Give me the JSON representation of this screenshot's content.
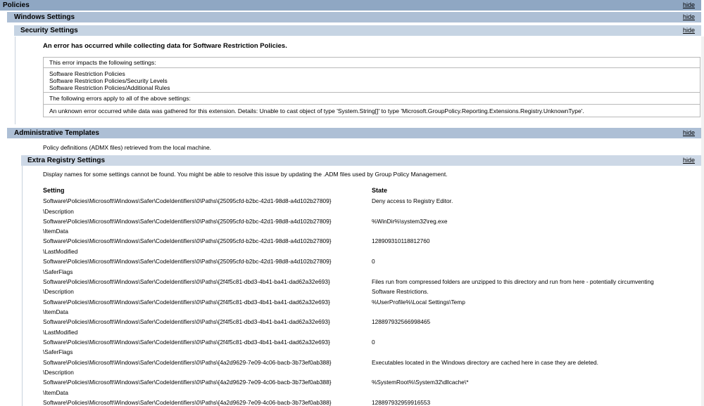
{
  "policies": {
    "title": "Policies",
    "hide": "hide"
  },
  "windows_settings": {
    "title": "Windows Settings",
    "hide": "hide"
  },
  "security_settings": {
    "title": "Security Settings",
    "hide": "hide"
  },
  "error": {
    "title": "An error has occurred while collecting data for Software Restriction Policies.",
    "impacts_label": "This error impacts the following settings:",
    "impacted": [
      "Software Restriction Policies",
      "Software Restriction Policies/Security Levels",
      "Software Restriction Policies/Additional Rules"
    ],
    "applies_label": "The following errors apply to all of the above settings:",
    "detail": "An unknown error occurred while data was gathered for this extension. Details: Unable to cast object of type 'System.String[]' to type 'Microsoft.GroupPolicy.Reporting.Extensions.Registry.UnknownType'."
  },
  "admin_templates": {
    "title": "Administrative Templates",
    "hide": "hide",
    "desc": "Policy definitions (ADMX files) retrieved from the local machine."
  },
  "extra_registry": {
    "title": "Extra Registry Settings",
    "hide": "hide",
    "desc": "Display names for some settings cannot be found. You might be able to resolve this issue by updating the .ADM files used by Group Policy Management.",
    "col_setting": "Setting",
    "col_state": "State",
    "rows": [
      {
        "setting": "Software\\Policies\\Microsoft\\Windows\\Safer\\CodeIdentifiers\\0\\Paths\\{25095cfd-b2bc-42d1-98d8-a4d102b27809}",
        "setting2": "\\Description",
        "state": "Deny access to Registry Editor.",
        "state2": ""
      },
      {
        "setting": "Software\\Policies\\Microsoft\\Windows\\Safer\\CodeIdentifiers\\0\\Paths\\{25095cfd-b2bc-42d1-98d8-a4d102b27809}",
        "setting2": "\\ItemData",
        "state": "%WinDir%\\system32\\reg.exe",
        "state2": ""
      },
      {
        "setting": "Software\\Policies\\Microsoft\\Windows\\Safer\\CodeIdentifiers\\0\\Paths\\{25095cfd-b2bc-42d1-98d8-a4d102b27809}",
        "setting2": "\\LastModified",
        "state": "128909310118812760",
        "state2": ""
      },
      {
        "setting": "Software\\Policies\\Microsoft\\Windows\\Safer\\CodeIdentifiers\\0\\Paths\\{25095cfd-b2bc-42d1-98d8-a4d102b27809}",
        "setting2": "\\SaferFlags",
        "state": "0",
        "state2": ""
      },
      {
        "setting": "Software\\Policies\\Microsoft\\Windows\\Safer\\CodeIdentifiers\\0\\Paths\\{2f4f5c81-dbd3-4b41-ba41-dad62a32e693}",
        "setting2": "\\Description",
        "state": "Files run from compressed folders are unzipped to this directory and run from here - potentially circumventing",
        "state2": "Software Restrictions."
      },
      {
        "setting": "Software\\Policies\\Microsoft\\Windows\\Safer\\CodeIdentifiers\\0\\Paths\\{2f4f5c81-dbd3-4b41-ba41-dad62a32e693}",
        "setting2": "\\ItemData",
        "state": "%UserProfile%\\Local Settings\\Temp",
        "state2": ""
      },
      {
        "setting": "Software\\Policies\\Microsoft\\Windows\\Safer\\CodeIdentifiers\\0\\Paths\\{2f4f5c81-dbd3-4b41-ba41-dad62a32e693}",
        "setting2": "\\LastModified",
        "state": "128897932566998465",
        "state2": ""
      },
      {
        "setting": "Software\\Policies\\Microsoft\\Windows\\Safer\\CodeIdentifiers\\0\\Paths\\{2f4f5c81-dbd3-4b41-ba41-dad62a32e693}",
        "setting2": "\\SaferFlags",
        "state": "0",
        "state2": ""
      },
      {
        "setting": "Software\\Policies\\Microsoft\\Windows\\Safer\\CodeIdentifiers\\0\\Paths\\{4a2d9629-7e09-4c06-bacb-3b73ef0ab388}",
        "setting2": "\\Description",
        "state": "Executables located in the Windows directory are cached here in case they are deleted.",
        "state2": ""
      },
      {
        "setting": "Software\\Policies\\Microsoft\\Windows\\Safer\\CodeIdentifiers\\0\\Paths\\{4a2d9629-7e09-4c06-bacb-3b73ef0ab388}",
        "setting2": "\\ItemData",
        "state": "%SystemRoot%\\System32\\dllcache\\*",
        "state2": ""
      },
      {
        "setting": "Software\\Policies\\Microsoft\\Windows\\Safer\\CodeIdentifiers\\0\\Paths\\{4a2d9629-7e09-4c06-bacb-3b73ef0ab388}",
        "setting2": "",
        "state": "128897932959916553",
        "state2": ""
      }
    ]
  }
}
